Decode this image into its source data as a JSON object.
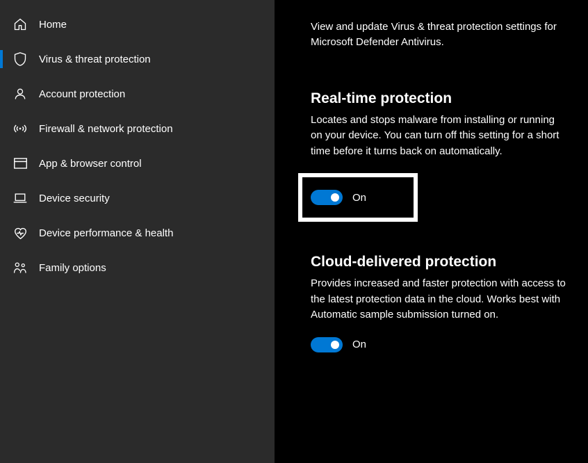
{
  "sidebar": {
    "items": [
      {
        "label": "Home"
      },
      {
        "label": "Virus & threat protection"
      },
      {
        "label": "Account protection"
      },
      {
        "label": "Firewall & network protection"
      },
      {
        "label": "App & browser control"
      },
      {
        "label": "Device security"
      },
      {
        "label": "Device performance & health"
      },
      {
        "label": "Family options"
      }
    ],
    "selectedIndex": 1
  },
  "main": {
    "intro": "View and update Virus & threat protection settings for Microsoft Defender Antivirus.",
    "sections": [
      {
        "title": "Real-time protection",
        "desc": "Locates and stops malware from installing or running on your device. You can turn off this setting for a short time before it turns back on automatically.",
        "toggle": {
          "state": "On"
        },
        "highlighted": true
      },
      {
        "title": "Cloud-delivered protection",
        "desc": "Provides increased and faster protection with access to the latest protection data in the cloud. Works best with Automatic sample submission turned on.",
        "toggle": {
          "state": "On"
        },
        "highlighted": false
      }
    ]
  }
}
